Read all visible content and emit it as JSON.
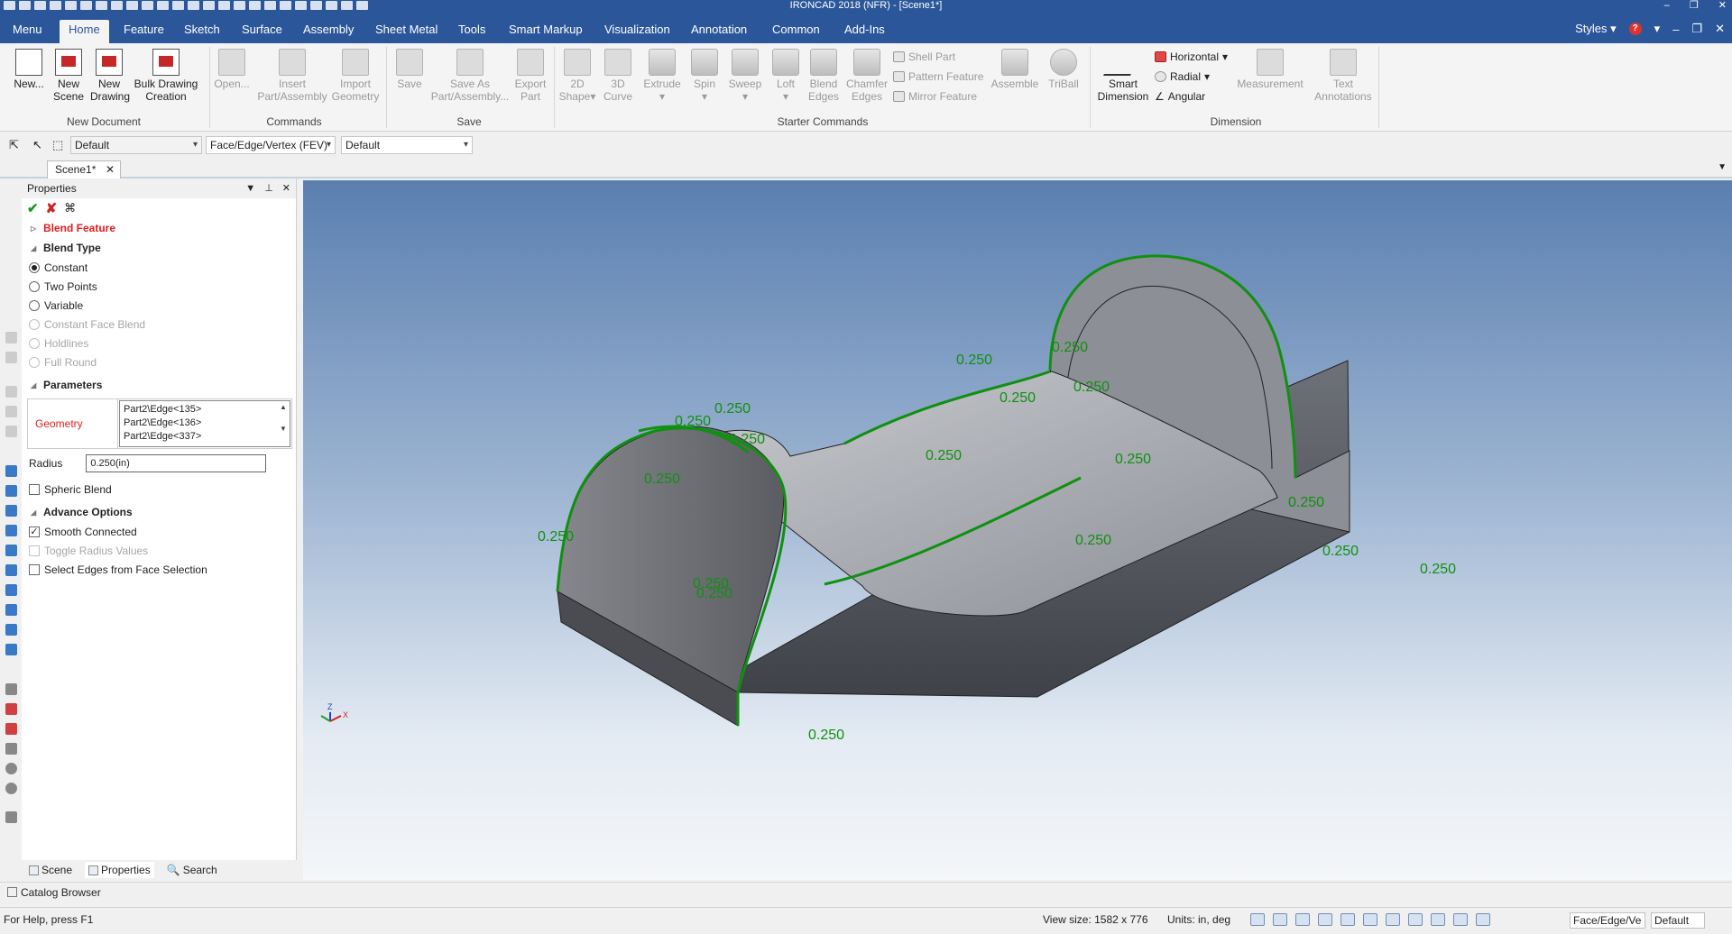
{
  "window": {
    "title": "IRONCAD 2018 (NFR) - [Scene1*]"
  },
  "menu_tabs": [
    "Menu",
    "Home",
    "Feature",
    "Sketch",
    "Surface",
    "Assembly",
    "Sheet Metal",
    "Tools",
    "Smart Markup",
    "Visualization",
    "Annotation",
    "Common",
    "Add-Ins"
  ],
  "active_tab": "Home",
  "menu_right": {
    "styles": "Styles"
  },
  "ribbon": {
    "new_document": {
      "label": "New Document",
      "new": "New...",
      "new_scene": [
        "New",
        "Scene"
      ],
      "new_drawing": [
        "New",
        "Drawing"
      ],
      "bulk_drawing": [
        "Bulk Drawing",
        "Creation"
      ]
    },
    "commands": {
      "label": "Commands",
      "open": "Open...",
      "insert": [
        "Insert",
        "Part/Assembly"
      ],
      "import": [
        "Import",
        "Geometry"
      ]
    },
    "save": {
      "label": "Save",
      "save": "Save",
      "save_as": [
        "Save As",
        "Part/Assembly..."
      ],
      "export": [
        "Export",
        "Part"
      ]
    },
    "starter": {
      "label": "Starter Commands",
      "shape2d": [
        "2D",
        "Shape"
      ],
      "curve3d": [
        "3D",
        "Curve"
      ],
      "extrude": "Extrude",
      "spin": "Spin",
      "sweep": "Sweep",
      "loft": "Loft",
      "blend": [
        "Blend",
        "Edges"
      ],
      "chamfer": [
        "Chamfer",
        "Edges"
      ],
      "shell": "Shell Part",
      "pattern": "Pattern Feature",
      "mirror": "Mirror Feature",
      "assemble": "Assemble",
      "triball": "TriBall"
    },
    "dimension": {
      "label": "Dimension",
      "smart": [
        "Smart",
        "Dimension"
      ],
      "horizontal": "Horizontal",
      "radial": "Radial",
      "angular": "Angular",
      "measurement": "Measurement",
      "text": [
        "Text",
        "Annotations"
      ]
    }
  },
  "toolbar2": {
    "style_select": "Default",
    "filter_select": "Face/Edge/Vertex (FEV)",
    "style2_select": "Default"
  },
  "doc_tab": "Scene1*",
  "properties": {
    "title": "Properties",
    "feature": "Blend Feature",
    "blend_type_label": "Blend Type",
    "blend_types": [
      {
        "label": "Constant",
        "checked": true,
        "enabled": true
      },
      {
        "label": "Two Points",
        "checked": false,
        "enabled": true
      },
      {
        "label": "Variable",
        "checked": false,
        "enabled": true
      },
      {
        "label": "Constant Face Blend",
        "checked": false,
        "enabled": false
      },
      {
        "label": "Holdlines",
        "checked": false,
        "enabled": false
      },
      {
        "label": "Full Round",
        "checked": false,
        "enabled": false
      }
    ],
    "parameters_label": "Parameters",
    "geometry_label": "Geometry",
    "geometry_items": [
      "Part2\\Edge<135>",
      "Part2\\Edge<136>",
      "Part2\\Edge<337>"
    ],
    "radius_label": "Radius",
    "radius_value": "0.250(in)",
    "spheric_blend": "Spheric Blend",
    "advance_label": "Advance Options",
    "advance_options": [
      {
        "label": "Smooth Connected",
        "checked": true,
        "enabled": true
      },
      {
        "label": "Toggle Radius Values",
        "checked": false,
        "enabled": false
      },
      {
        "label": "Select Edges from Face Selection",
        "checked": false,
        "enabled": true
      }
    ]
  },
  "panel_tabs": [
    "Scene",
    "Properties",
    "Search"
  ],
  "catalog": "Catalog Browser",
  "status": {
    "help": "For Help, press F1",
    "view_size": "View size: 1582 x 776",
    "units": "Units: in, deg",
    "select_mode": "Face/Edge/Ve",
    "style": "Default"
  },
  "dimension_labels": {
    "value": "0.250",
    "count": 18
  },
  "triad": {
    "z": "Z",
    "x": "X"
  },
  "colors": {
    "accent": "#2b579a",
    "blend_highlight": "#109010",
    "error_red": "#e01c1c"
  }
}
